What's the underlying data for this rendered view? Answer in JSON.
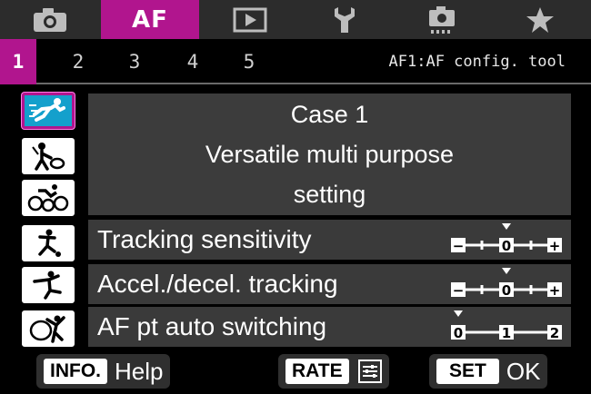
{
  "tabs": [
    {
      "name": "camera-icon",
      "label": ""
    },
    {
      "name": "af-tab",
      "label": "AF"
    },
    {
      "name": "playback-icon",
      "label": ""
    },
    {
      "name": "wrench-icon",
      "label": ""
    },
    {
      "name": "camera-settings-icon",
      "label": ""
    },
    {
      "name": "star-icon",
      "label": ""
    }
  ],
  "pages": [
    "1",
    "2",
    "3",
    "4",
    "5"
  ],
  "menu_title": "AF1:AF config. tool",
  "cases": [
    {
      "icon": "runner-icon",
      "selected": true
    },
    {
      "icon": "tennis-player-icon",
      "selected": false
    },
    {
      "icon": "cyclists-icon",
      "selected": false
    },
    {
      "icon": "soccer-player-icon",
      "selected": false
    },
    {
      "icon": "skater-icon",
      "selected": false
    },
    {
      "icon": "gymnast-icon",
      "selected": false
    }
  ],
  "description": {
    "line1": "Case 1",
    "line2": "Versatile multi purpose",
    "line3": "setting"
  },
  "params": [
    {
      "label": "Tracking sensitivity",
      "scale": [
        "−",
        "0",
        "+"
      ],
      "value": 0
    },
    {
      "label": "Accel./decel. tracking",
      "scale": [
        "−",
        "0",
        "+"
      ],
      "value": 0
    },
    {
      "label": "AF pt auto switching",
      "scale": [
        "0",
        "1",
        "2"
      ],
      "value": 0
    }
  ],
  "buttons": {
    "info_key": "INFO.",
    "info_text": "Help",
    "rate_key": "RATE",
    "set_key": "SET",
    "set_text": "OK"
  },
  "colors": {
    "accent": "#b1158e",
    "selected_icon_bg": "#14a0cc"
  }
}
